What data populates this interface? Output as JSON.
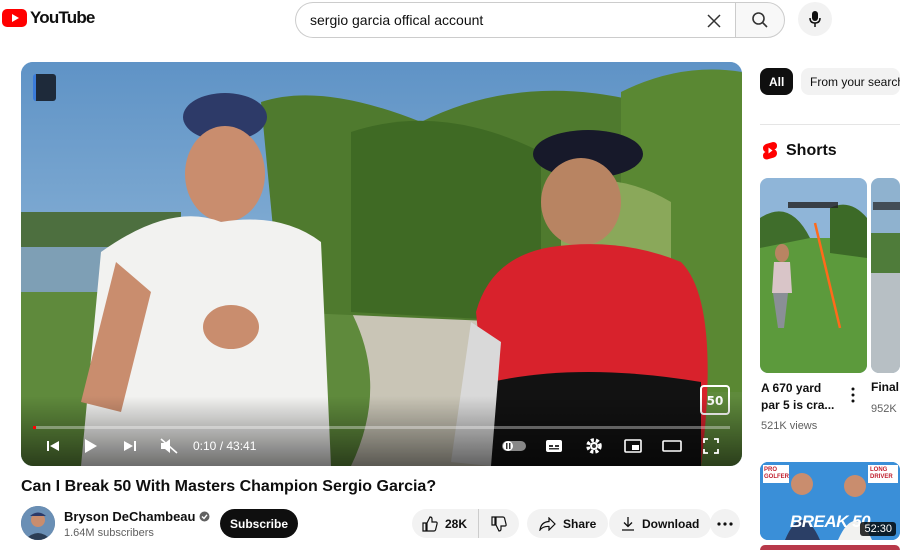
{
  "header": {
    "logo_text": "YouTube",
    "search_value": "sergio garcia offical account"
  },
  "player": {
    "time": "0:10 / 43:41",
    "progress_fraction": 0.004
  },
  "video": {
    "title": "Can I Break 50 With Masters Champion Sergio Garcia?",
    "channel": "Bryson DeChambeau",
    "subscribers": "1.64M subscribers",
    "subscribe_label": "Subscribe",
    "likes": "28K",
    "share_label": "Share",
    "download_label": "Download"
  },
  "sidebar": {
    "chips": [
      "All",
      "From your search"
    ],
    "shorts_label": "Shorts",
    "shorts": [
      {
        "title": "A 670 yard par 5 is cra...",
        "views": "521K views"
      },
      {
        "title": "Final",
        "views": "952K"
      }
    ],
    "recommended": [
      {
        "duration": "52:30",
        "badge_left": "PRO GOLFER",
        "badge_right": "LONG DRIVER",
        "thumb_text": "BREAK 50"
      }
    ]
  },
  "colors": {
    "brand_red": "#ff0000",
    "accent_dark": "#0f0f0f",
    "pill_bg": "#f2f2f2"
  }
}
